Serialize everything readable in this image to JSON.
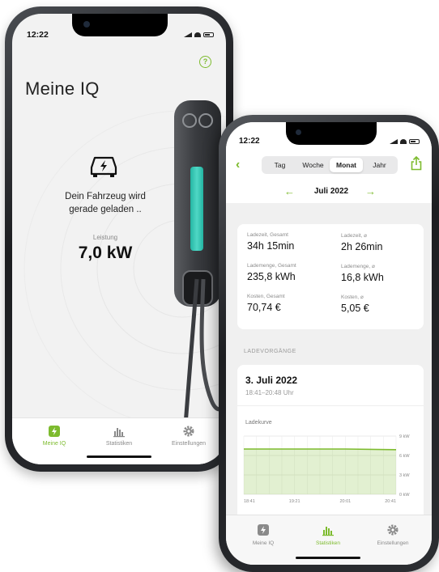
{
  "phone1": {
    "time": "12:22",
    "title": "Meine IQ",
    "charging_line1": "Dein Fahrzeug wird",
    "charging_line2": "gerade geladen ..",
    "power_label": "Leistung",
    "power_value": "7,0 kW",
    "tabs": [
      {
        "label": "Meine IQ",
        "icon": "bolt-icon",
        "active": true
      },
      {
        "label": "Statistiken",
        "icon": "bar-chart-icon",
        "active": false
      },
      {
        "label": "Einstellungen",
        "icon": "gear-icon",
        "active": false
      }
    ]
  },
  "phone2": {
    "time": "12:22",
    "periods": [
      "Tag",
      "Woche",
      "Monat",
      "Jahr"
    ],
    "selected_period": "Monat",
    "month": "Juli 2022",
    "stats": [
      {
        "label": "Ladezeit, Gesamt",
        "value": "34h 15min"
      },
      {
        "label": "Ladezeit, ⌀",
        "value": "2h 26min"
      },
      {
        "label": "Lademenge, Gesamt",
        "value": "235,8 kWh"
      },
      {
        "label": "Lademenge, ⌀",
        "value": "16,8 kWh"
      },
      {
        "label": "Kosten, Gesamt",
        "value": "70,74 €"
      },
      {
        "label": "Kosten, ⌀",
        "value": "5,05 €"
      }
    ],
    "section_label": "LADEVORGÄNGE",
    "session": {
      "date": "3. Juli 2022",
      "time_range": "18:41–20:48 Uhr",
      "curve_label": "Ladekurve"
    },
    "tabs": [
      {
        "label": "Meine IQ",
        "icon": "bolt-icon",
        "active": false
      },
      {
        "label": "Statistiken",
        "icon": "bar-chart-icon",
        "active": true
      },
      {
        "label": "Einstellungen",
        "icon": "gear-icon",
        "active": false
      }
    ]
  },
  "colors": {
    "accent": "#7dbb2e",
    "led": "#3fcfbc"
  },
  "chart_data": {
    "type": "area",
    "x": [
      "18:41",
      "19:21",
      "20:01",
      "20:41"
    ],
    "series": [
      {
        "values": [
          7.0,
          7.0,
          7.0,
          6.9
        ]
      }
    ],
    "y_ticks": [
      "9 kW",
      "6 kW",
      "3 kW",
      "0 kW"
    ],
    "ylim": [
      0,
      9
    ],
    "ylabel": "",
    "title": ""
  }
}
